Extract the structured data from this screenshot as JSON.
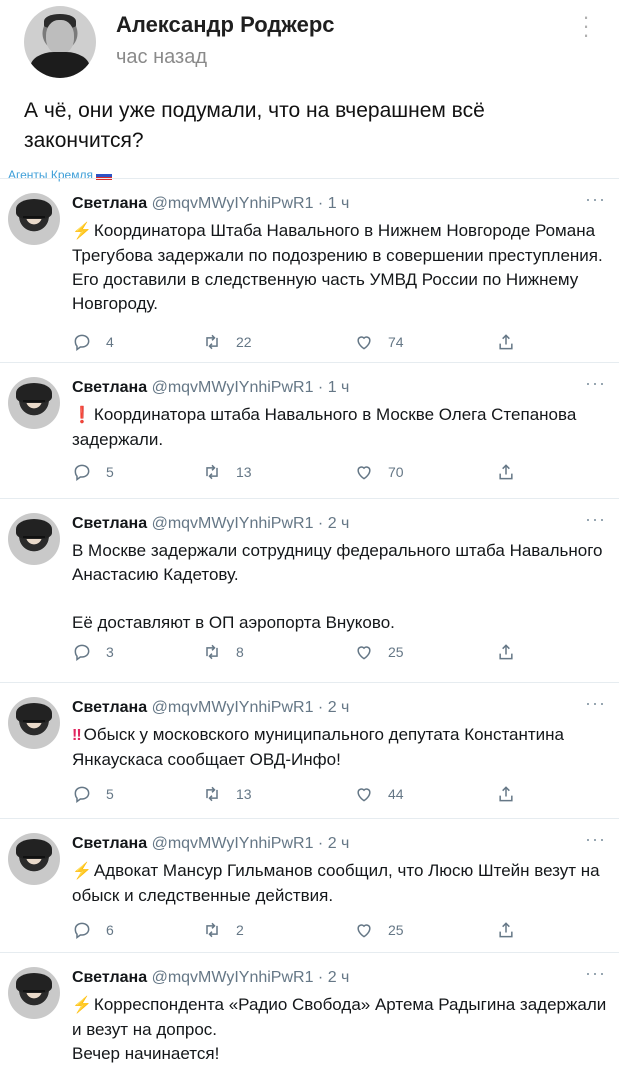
{
  "post": {
    "author": "Александр Роджерс",
    "time": "час назад",
    "text": "А чё, они уже подумали, что на вчерашнем всё закончится?"
  },
  "source_tag": "Агенты Кремля",
  "tweets": [
    {
      "name": "Светлана",
      "meta": "@mqvMWyIYnhiPwR1 · 1 ч",
      "emoji": "⚡",
      "emoji_type": "bolt",
      "text": "Координатора Штаба Навального в Нижнем Новгороде Романа Трегубова задержали по подозрению в совершении преступления. Его доставили в следственную часть УМВД России по Нижнему Новгороду.",
      "replies": "4",
      "retweets": "22",
      "likes": "74"
    },
    {
      "name": "Светлана",
      "meta": "@mqvMWyIYnhiPwR1 · 1 ч",
      "emoji": "❗",
      "emoji_type": "excl",
      "text": "Координатора штаба Навального в Москве Олега Степанова задержали.",
      "replies": "5",
      "retweets": "13",
      "likes": "70"
    },
    {
      "name": "Светлана",
      "meta": "@mqvMWyIYnhiPwR1 · 2 ч",
      "emoji": "",
      "emoji_type": "",
      "text": "В Москве задержали сотрудницу федерального штаба Навального Анастасию Кадетову.\n\nЕё доставляют в ОП аэропорта Внуково.",
      "replies": "3",
      "retweets": "8",
      "likes": "25"
    },
    {
      "name": "Светлана",
      "meta": "@mqvMWyIYnhiPwR1 · 2 ч",
      "emoji": "‼",
      "emoji_type": "excl",
      "text": "Обыск у московского муниципального депутата Константина Янкаускаса сообщает ОВД-Инфо!",
      "replies": "5",
      "retweets": "13",
      "likes": "44"
    },
    {
      "name": "Светлана",
      "meta": "@mqvMWyIYnhiPwR1 · 2 ч",
      "emoji": "⚡",
      "emoji_type": "bolt",
      "text": "Адвокат Мансур Гильманов сообщил, что Люсю Штейн везут на обыск и следственные действия.",
      "replies": "6",
      "retweets": "2",
      "likes": "25"
    },
    {
      "name": "Светлана",
      "meta": "@mqvMWyIYnhiPwR1 · 2 ч",
      "emoji": "⚡",
      "emoji_type": "bolt",
      "text": "Корреспондента «Радио Свобода» Артема Радыгина задержали и везут на допрос.\nВечер начинается!",
      "replies": "",
      "retweets": "",
      "likes": ""
    }
  ],
  "icons": {
    "reply": "reply-icon",
    "retweet": "retweet-icon",
    "like": "heart-icon",
    "share": "share-icon",
    "more": "more-dots-icon",
    "flag": "russia-flag-icon"
  },
  "colors": {
    "bolt": "#f5b800",
    "exclamation": "#e0245e",
    "source_tag": "#3f9fd8",
    "meta": "#657786"
  }
}
